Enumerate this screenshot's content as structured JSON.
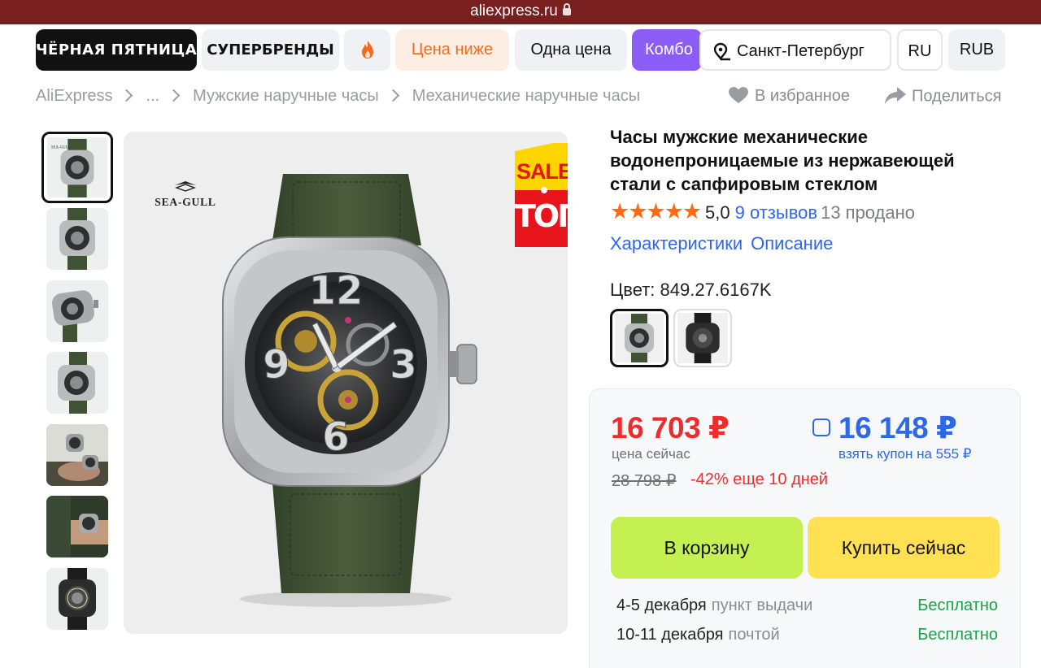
{
  "browser": {
    "url": "aliexpress.ru"
  },
  "chips": {
    "black_friday": "ЧЁРНАЯ ПЯТНИЦА",
    "superbrands": "СУПЕРБРЕНДЫ",
    "fire_icon": "flame-icon",
    "price_lower": "Цена ниже",
    "one_price": "Одна цена",
    "combo": "Комбо",
    "city": "Санкт-Петербург",
    "language": "RU",
    "currency": "RUB"
  },
  "breadcrumbs": [
    "AliExpress",
    "...",
    "Мужские наручные часы",
    "Механические наручные часы"
  ],
  "actions": {
    "favorite": "В избранное",
    "share": "Поделиться"
  },
  "gallery": {
    "brand": "SEA-GULL",
    "badge_top": "SALE",
    "badge_bottom": "ТОП",
    "thumbnail_count": 7
  },
  "product": {
    "title": "Часы мужские механические водонепроницаемые из нержавеющей стали с сапфировым стеклом",
    "stars": "★★★★★",
    "rating": "5,0",
    "reviews": "9 отзывов",
    "sold": "13 продано",
    "tabs": [
      "Характеристики",
      "Описание"
    ],
    "color_label": "Цвет: 849.27.6167K"
  },
  "price": {
    "current": "16 703 ₽",
    "current_caption": "цена сейчас",
    "coupon_price": "16 148 ₽",
    "coupon_caption": "взять купон на 555 ₽",
    "old": "28 798 ₽",
    "discount": "-42% еще 10 дней",
    "add_to_cart": "В корзину",
    "buy_now": "Купить сейчас"
  },
  "delivery": [
    {
      "date": "4-5 декабря",
      "method": "пункт выдачи",
      "cost": "Бесплатно"
    },
    {
      "date": "10-11 декабря",
      "method": "почтой",
      "cost": "Бесплатно"
    }
  ],
  "colors": {
    "accent_red": "#ef2b2b",
    "accent_blue": "#2e67e8",
    "cart_green": "#c4f052",
    "buy_yellow": "#ffe153",
    "free_green": "#19a347",
    "combo_purple": "#8b5cf6",
    "star_orange": "#ff6a13"
  }
}
